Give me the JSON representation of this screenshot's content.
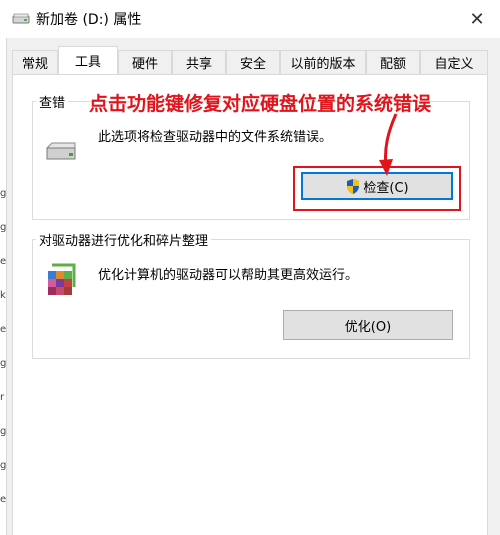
{
  "window": {
    "title": "新加卷 (D:) 属性",
    "close_label": "✕"
  },
  "tabs": [
    {
      "label": "常规"
    },
    {
      "label": "工具",
      "active": true
    },
    {
      "label": "硬件"
    },
    {
      "label": "共享"
    },
    {
      "label": "安全"
    },
    {
      "label": "以前的版本"
    },
    {
      "label": "配额"
    },
    {
      "label": "自定义"
    }
  ],
  "error_check": {
    "group_title": "查错",
    "description": "此选项将检查驱动器中的文件系统错误。",
    "button_label": "检查(C)",
    "icon": "drive-icon",
    "button_icon": "uac-shield-icon"
  },
  "optimize": {
    "group_title": "对驱动器进行优化和碎片整理",
    "description": "优化计算机的驱动器可以帮助其更高效运行。",
    "button_label": "优化(O)",
    "icon": "defrag-icon"
  },
  "annotation": {
    "text": "点击功能键修复对应硬盘位置的系统错误",
    "color": "#e0141a"
  },
  "left_edge_chars": [
    "g",
    "g",
    "e",
    "k",
    "e",
    "g",
    "r",
    "g",
    "g",
    "e"
  ]
}
